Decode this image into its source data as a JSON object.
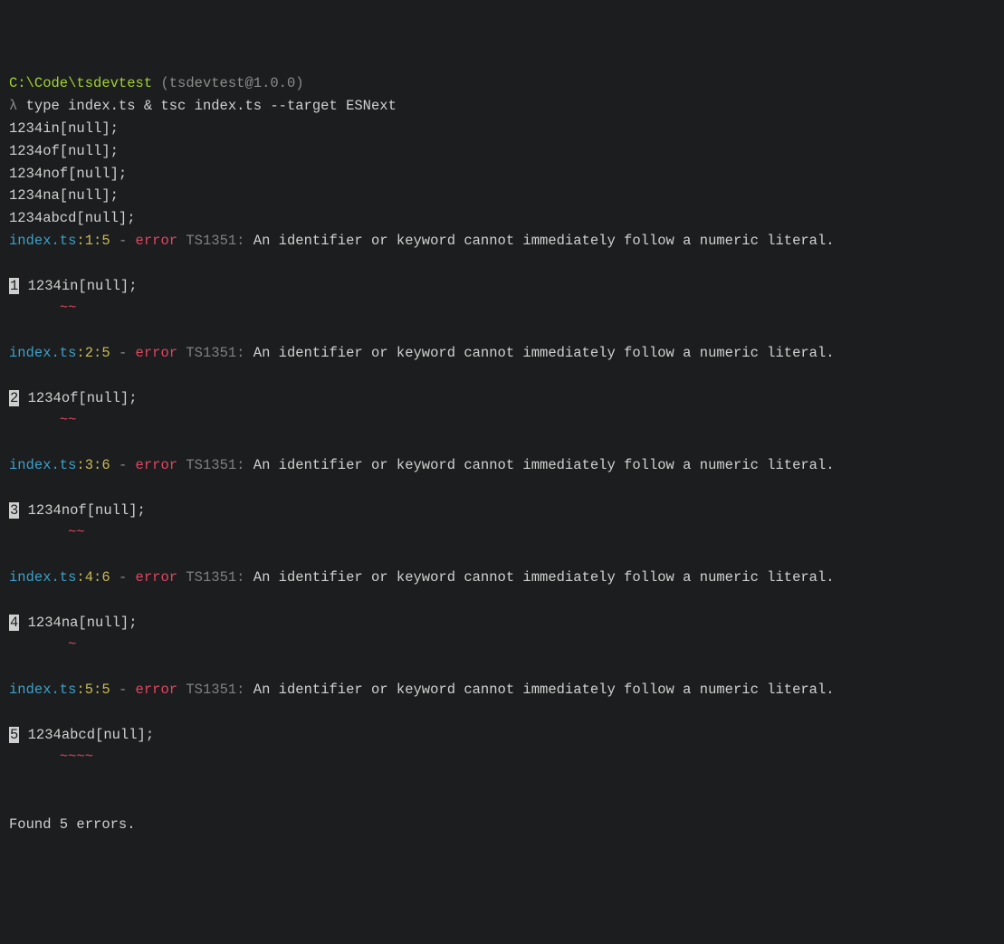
{
  "header": {
    "cwd": "C:\\Code\\tsdevtest",
    "pkg_open": " (",
    "pkg": "tsdevtest@1.0.0",
    "pkg_close": ")",
    "prompt": "λ ",
    "command": "type index.ts & tsc index.ts --target ESNext"
  },
  "output_lines": [
    "1234in[null];",
    "1234of[null];",
    "1234nof[null];",
    "1234na[null];",
    "1234abcd[null];"
  ],
  "errors": [
    {
      "file": "index.ts",
      "position": ":1:5",
      "dash": " - ",
      "error_label": "error",
      "code": " TS1351: ",
      "message": "An identifier or keyword cannot immediately follow a numeric literal.",
      "lineno": "1",
      "source": " 1234in[null];",
      "squiggle_pad": "      ",
      "squiggle": "~~"
    },
    {
      "file": "index.ts",
      "position": ":2:5",
      "dash": " - ",
      "error_label": "error",
      "code": " TS1351: ",
      "message": "An identifier or keyword cannot immediately follow a numeric literal.",
      "lineno": "2",
      "source": " 1234of[null];",
      "squiggle_pad": "      ",
      "squiggle": "~~"
    },
    {
      "file": "index.ts",
      "position": ":3:6",
      "dash": " - ",
      "error_label": "error",
      "code": " TS1351: ",
      "message": "An identifier or keyword cannot immediately follow a numeric literal.",
      "lineno": "3",
      "source": " 1234nof[null];",
      "squiggle_pad": "       ",
      "squiggle": "~~"
    },
    {
      "file": "index.ts",
      "position": ":4:6",
      "dash": " - ",
      "error_label": "error",
      "code": " TS1351: ",
      "message": "An identifier or keyword cannot immediately follow a numeric literal.",
      "lineno": "4",
      "source": " 1234na[null];",
      "squiggle_pad": "       ",
      "squiggle": "~"
    },
    {
      "file": "index.ts",
      "position": ":5:5",
      "dash": " - ",
      "error_label": "error",
      "code": " TS1351: ",
      "message": "An identifier or keyword cannot immediately follow a numeric literal.",
      "lineno": "5",
      "source": " 1234abcd[null];",
      "squiggle_pad": "      ",
      "squiggle": "~~~~"
    }
  ],
  "footer": "Found 5 errors."
}
